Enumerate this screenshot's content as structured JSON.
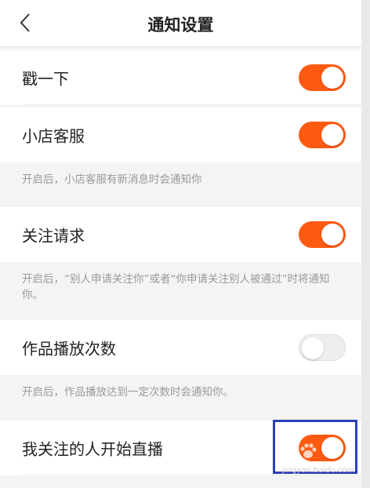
{
  "header": {
    "title": "通知设置"
  },
  "settings": [
    {
      "label": "戳一下",
      "enabled": true
    },
    {
      "label": "小店客服",
      "enabled": true,
      "hint": "开启后，小店客服有新消息时会通知你"
    },
    {
      "label": "关注请求",
      "enabled": true,
      "hint": "开启后，“别人申请关注你”或者“你申请关注别人被通过”时将通知你。"
    },
    {
      "label": "作品播放次数",
      "enabled": false,
      "hint": "开启后，作品播放达到一定次数时会通知你。"
    },
    {
      "label": "我关注的人开始直播",
      "enabled": true
    }
  ],
  "watermark": {
    "text": "jingyan.baidu.com"
  },
  "colors": {
    "toggle_on": "#ff5a12",
    "toggle_off": "#eeeeee",
    "highlight": "#2b3fb8"
  }
}
